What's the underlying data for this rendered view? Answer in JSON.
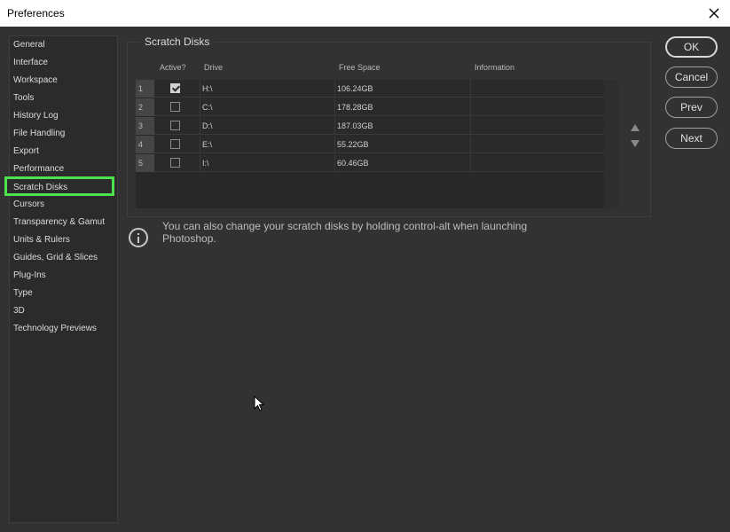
{
  "window": {
    "title": "Preferences",
    "close_icon": "close-icon"
  },
  "sidebar": {
    "items": [
      {
        "label": "General"
      },
      {
        "label": "Interface"
      },
      {
        "label": "Workspace"
      },
      {
        "label": "Tools"
      },
      {
        "label": "History Log"
      },
      {
        "label": "File Handling"
      },
      {
        "label": "Export"
      },
      {
        "label": "Performance"
      },
      {
        "label": "Scratch Disks",
        "selected": true
      },
      {
        "label": "Cursors"
      },
      {
        "label": "Transparency & Gamut"
      },
      {
        "label": "Units & Rulers"
      },
      {
        "label": "Guides, Grid & Slices"
      },
      {
        "label": "Plug-Ins"
      },
      {
        "label": "Type"
      },
      {
        "label": "3D"
      },
      {
        "label": "Technology Previews"
      }
    ]
  },
  "scratch_disks": {
    "title": "Scratch Disks",
    "columns": {
      "active": "Active?",
      "drive": "Drive",
      "free_space": "Free Space",
      "information": "Information"
    },
    "rows": [
      {
        "num": "1",
        "active": true,
        "drive": "H:\\",
        "free_space": "106.24GB",
        "information": ""
      },
      {
        "num": "2",
        "active": false,
        "drive": "C:\\",
        "free_space": "178.28GB",
        "information": ""
      },
      {
        "num": "3",
        "active": false,
        "drive": "D:\\",
        "free_space": "187.03GB",
        "information": ""
      },
      {
        "num": "4",
        "active": false,
        "drive": "E:\\",
        "free_space": "55.22GB",
        "information": ""
      },
      {
        "num": "5",
        "active": false,
        "drive": "I:\\",
        "free_space": "60.46GB",
        "information": ""
      }
    ]
  },
  "info": {
    "text": "You can also change your scratch disks by holding control-alt when launching Photoshop."
  },
  "buttons": {
    "ok": "OK",
    "cancel": "Cancel",
    "prev": "Prev",
    "next": "Next"
  },
  "colors": {
    "background": "#323232",
    "selection_highlight": "#4ee24e"
  }
}
